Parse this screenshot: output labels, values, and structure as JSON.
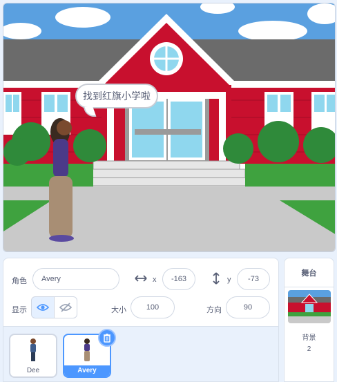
{
  "stage": {
    "speech_bubble": "找到红旗小学啦"
  },
  "sprite_info": {
    "sprite_label": "角色",
    "sprite_name": "Avery",
    "x_label": "x",
    "x_value": "-163",
    "y_label": "y",
    "y_value": "-73",
    "show_label": "显示",
    "size_label": "大小",
    "size_value": "100",
    "direction_label": "方向",
    "direction_value": "90"
  },
  "sprite_list": [
    {
      "name": "Dee",
      "selected": false
    },
    {
      "name": "Avery",
      "selected": true
    }
  ],
  "stage_panel": {
    "title": "舞台",
    "backdrops_label": "背景",
    "backdrops_count": "2"
  },
  "colors": {
    "accent": "#4c97ff",
    "school_red": "#c8102e",
    "text": "#575e75"
  }
}
